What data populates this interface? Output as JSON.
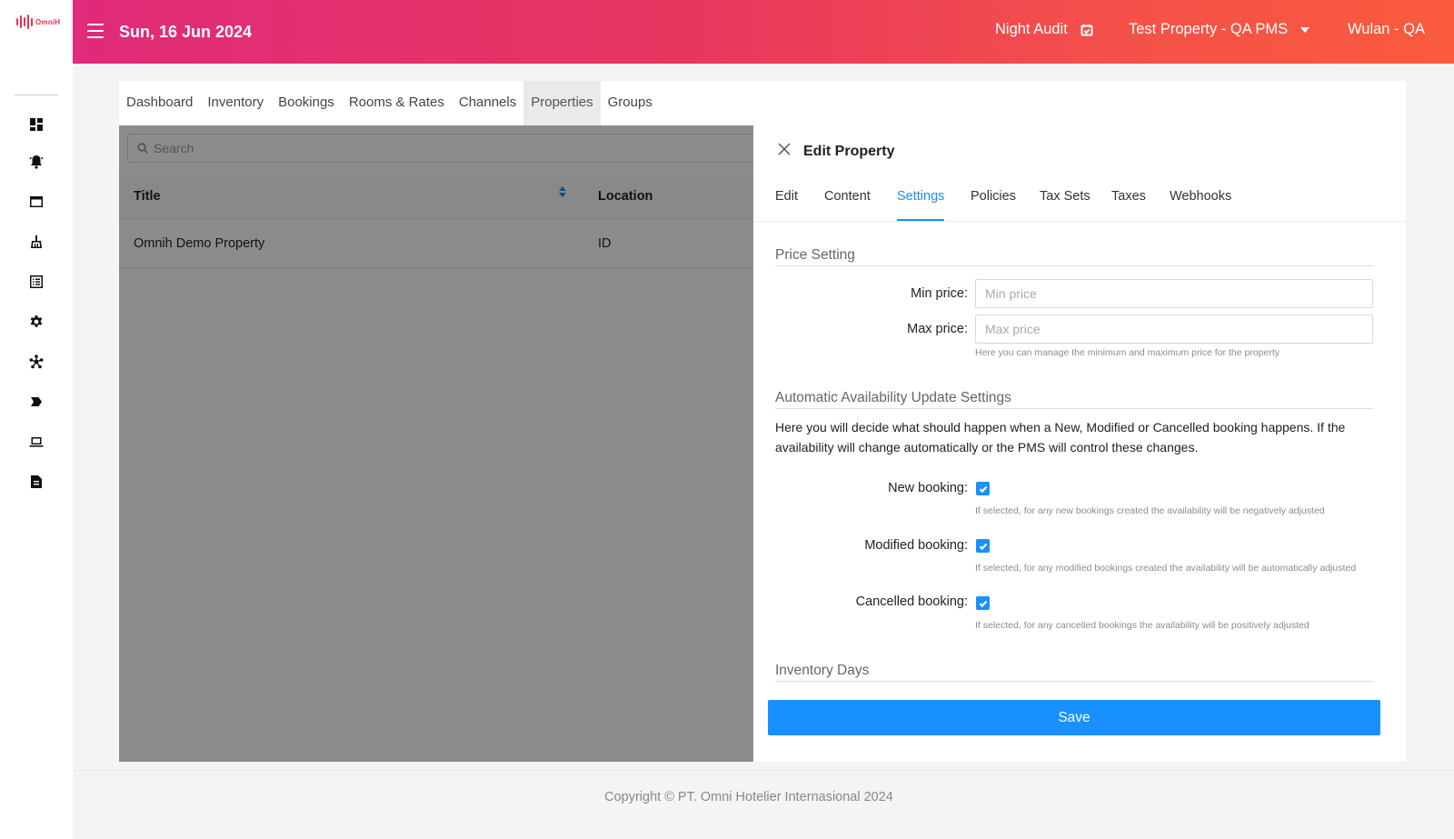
{
  "app": {
    "logo_text": "OmniH"
  },
  "header": {
    "date": "Sun, 16 Jun 2024",
    "night_audit": "Night Audit",
    "property": "Test Property - QA PMS",
    "user": "Wulan - QA"
  },
  "sidebar": {
    "icons": [
      "dashboard-icon",
      "bell-icon",
      "window-icon",
      "housekeeping-icon",
      "list-icon",
      "gear-icon",
      "network-icon",
      "tag-icon",
      "laptop-icon",
      "report-icon"
    ]
  },
  "nav": {
    "tabs": [
      {
        "label": "Dashboard"
      },
      {
        "label": "Inventory"
      },
      {
        "label": "Bookings"
      },
      {
        "label": "Rooms & Rates"
      },
      {
        "label": "Channels"
      },
      {
        "label": "Properties"
      },
      {
        "label": "Groups"
      }
    ],
    "active": "Properties"
  },
  "list": {
    "search_placeholder": "Search",
    "columns": [
      "Title",
      "Location"
    ],
    "rows": [
      {
        "title": "Omnih Demo Property",
        "location": "ID"
      }
    ]
  },
  "drawer": {
    "title": "Edit Property",
    "tabs": [
      "Edit",
      "Content",
      "Settings",
      "Policies",
      "Tax Sets",
      "Taxes",
      "Webhooks"
    ],
    "active_tab": "Settings",
    "price_setting": {
      "title": "Price Setting",
      "min_label": "Min price",
      "min_placeholder": "Min price",
      "max_label": "Max price",
      "max_placeholder": "Max price",
      "hint": "Here you can manage the minimum and maximum price for the property"
    },
    "availability": {
      "title": "Automatic Availability Update Settings",
      "description": "Here you will decide what should happen when a New, Modified or Cancelled booking happens. If the availability will change automatically or the PMS will control these changes.",
      "new_label": "New booking",
      "new_checked": true,
      "new_hint": "If selected, for any new bookings created the availability will be negatively adjusted",
      "modified_label": "Modified booking",
      "modified_checked": true,
      "modified_hint": "If selected, for any modified bookings created the availability will be automatically adjusted",
      "cancelled_label": "Cancelled booking",
      "cancelled_checked": true,
      "cancelled_hint": "If selected, for any cancelled bookings the availability will be positively adjusted"
    },
    "inventory_days": {
      "title": "Inventory Days"
    },
    "save_label": "Save"
  },
  "footer": {
    "copyright": "Copyright © PT. Omni Hotelier Internasional 2024"
  },
  "colors": {
    "accent": "#1890ff",
    "header_start": "#e02a7a",
    "header_end": "#fa5b3d"
  }
}
